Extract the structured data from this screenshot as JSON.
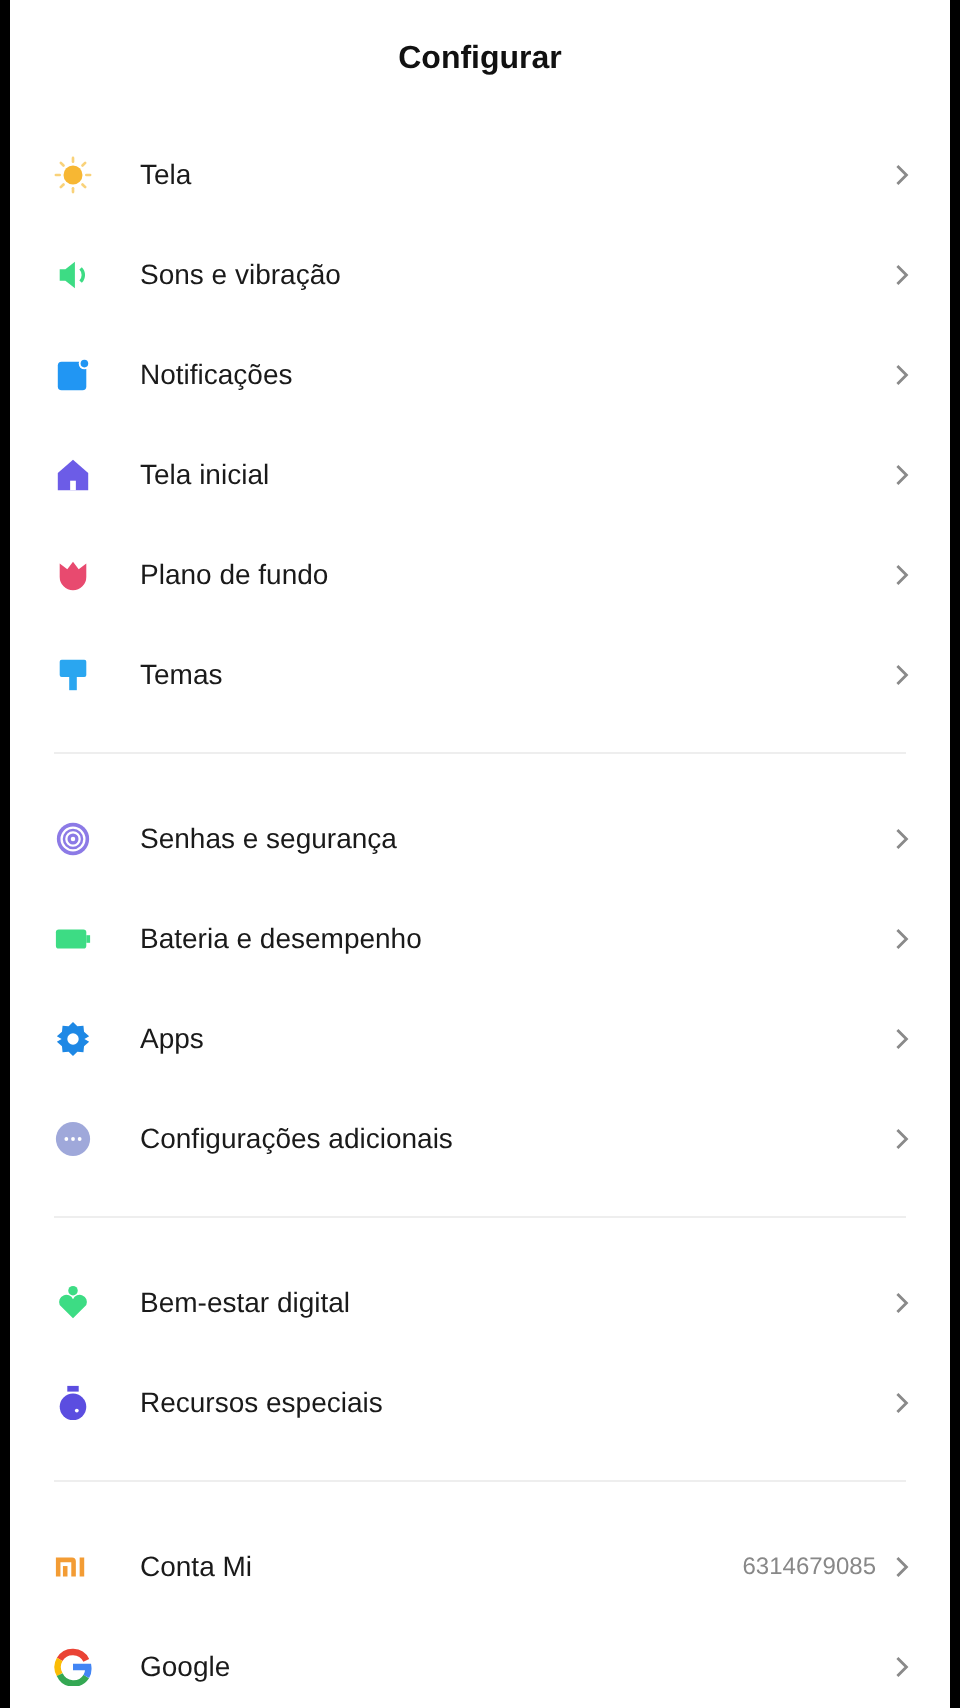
{
  "title": "Configurar",
  "groups": [
    {
      "items": [
        {
          "label": "Tela"
        },
        {
          "label": "Sons e vibração"
        },
        {
          "label": "Notificações"
        },
        {
          "label": "Tela inicial"
        },
        {
          "label": "Plano de fundo"
        },
        {
          "label": "Temas"
        }
      ]
    },
    {
      "items": [
        {
          "label": "Senhas e segurança"
        },
        {
          "label": "Bateria e desempenho"
        },
        {
          "label": "Apps"
        },
        {
          "label": "Configurações adicionais"
        }
      ]
    },
    {
      "items": [
        {
          "label": "Bem-estar digital"
        },
        {
          "label": "Recursos especiais"
        }
      ]
    },
    {
      "items": [
        {
          "label": "Conta Mi",
          "value": "6314679085"
        },
        {
          "label": "Google"
        }
      ]
    }
  ]
}
